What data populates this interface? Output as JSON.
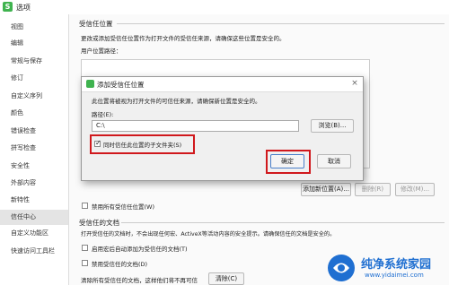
{
  "window": {
    "title": "选项"
  },
  "sidebar": {
    "items": [
      {
        "label": "视图"
      },
      {
        "label": "编辑"
      },
      {
        "label": "常规与保存"
      },
      {
        "label": "修订"
      },
      {
        "label": "自定义序列"
      },
      {
        "label": "颜色"
      },
      {
        "label": "错误检查"
      },
      {
        "label": "拼写检查"
      },
      {
        "label": "安全性"
      },
      {
        "label": "外部内容"
      },
      {
        "label": "新特性"
      },
      {
        "label": "信任中心"
      },
      {
        "label": "自定义功能区"
      },
      {
        "label": "快速访问工具栏"
      }
    ],
    "active_index": 11
  },
  "trusted_locations": {
    "section_title": "受信任位置",
    "description": "更改或添加受信任位置作为打开文件的受信任来源，请确保这些位置是安全的。",
    "path_column": "用户位置路径：",
    "add_button": "添加新位置(A)...",
    "remove_button": "删除(R)",
    "modify_button": "修改(M)...",
    "disable_all_label": "禁用所有受信任位置(W)"
  },
  "trusted_documents": {
    "section_title": "受信任的文档",
    "description": "打开受信任的文档时，不会出现任何宏、ActiveX等活动内容的安全提示。请确保信任的文档是安全的。",
    "enable_macro_label": "启用宏后自动添加为受信任的文档(T)",
    "disable_trusted_label": "禁用受信任的文档(D)",
    "clear_text": "清除所有受信任的文档，这样他们将不再可信",
    "clear_button": "清除(C)"
  },
  "dialog": {
    "title": "添加受信任位置",
    "warning": "此位置将被视为打开文件的可信任来源，请确保新位置是安全的。",
    "path_label": "路径(E):",
    "path_value": "C:\\",
    "browse_button": "浏览(B)...",
    "subfolders_label": "同时信任此位置的子文件夹(S)",
    "subfolders_checked": true,
    "ok_button": "确定",
    "cancel_button": "取消",
    "close_glyph": "×"
  },
  "watermark": {
    "title": "纯净系统家园",
    "url": "www.yidaimei.com"
  },
  "colors": {
    "highlight_red": "#d0181c",
    "brand_green": "#3fb34f",
    "watermark_blue": "#1f6fd1"
  }
}
